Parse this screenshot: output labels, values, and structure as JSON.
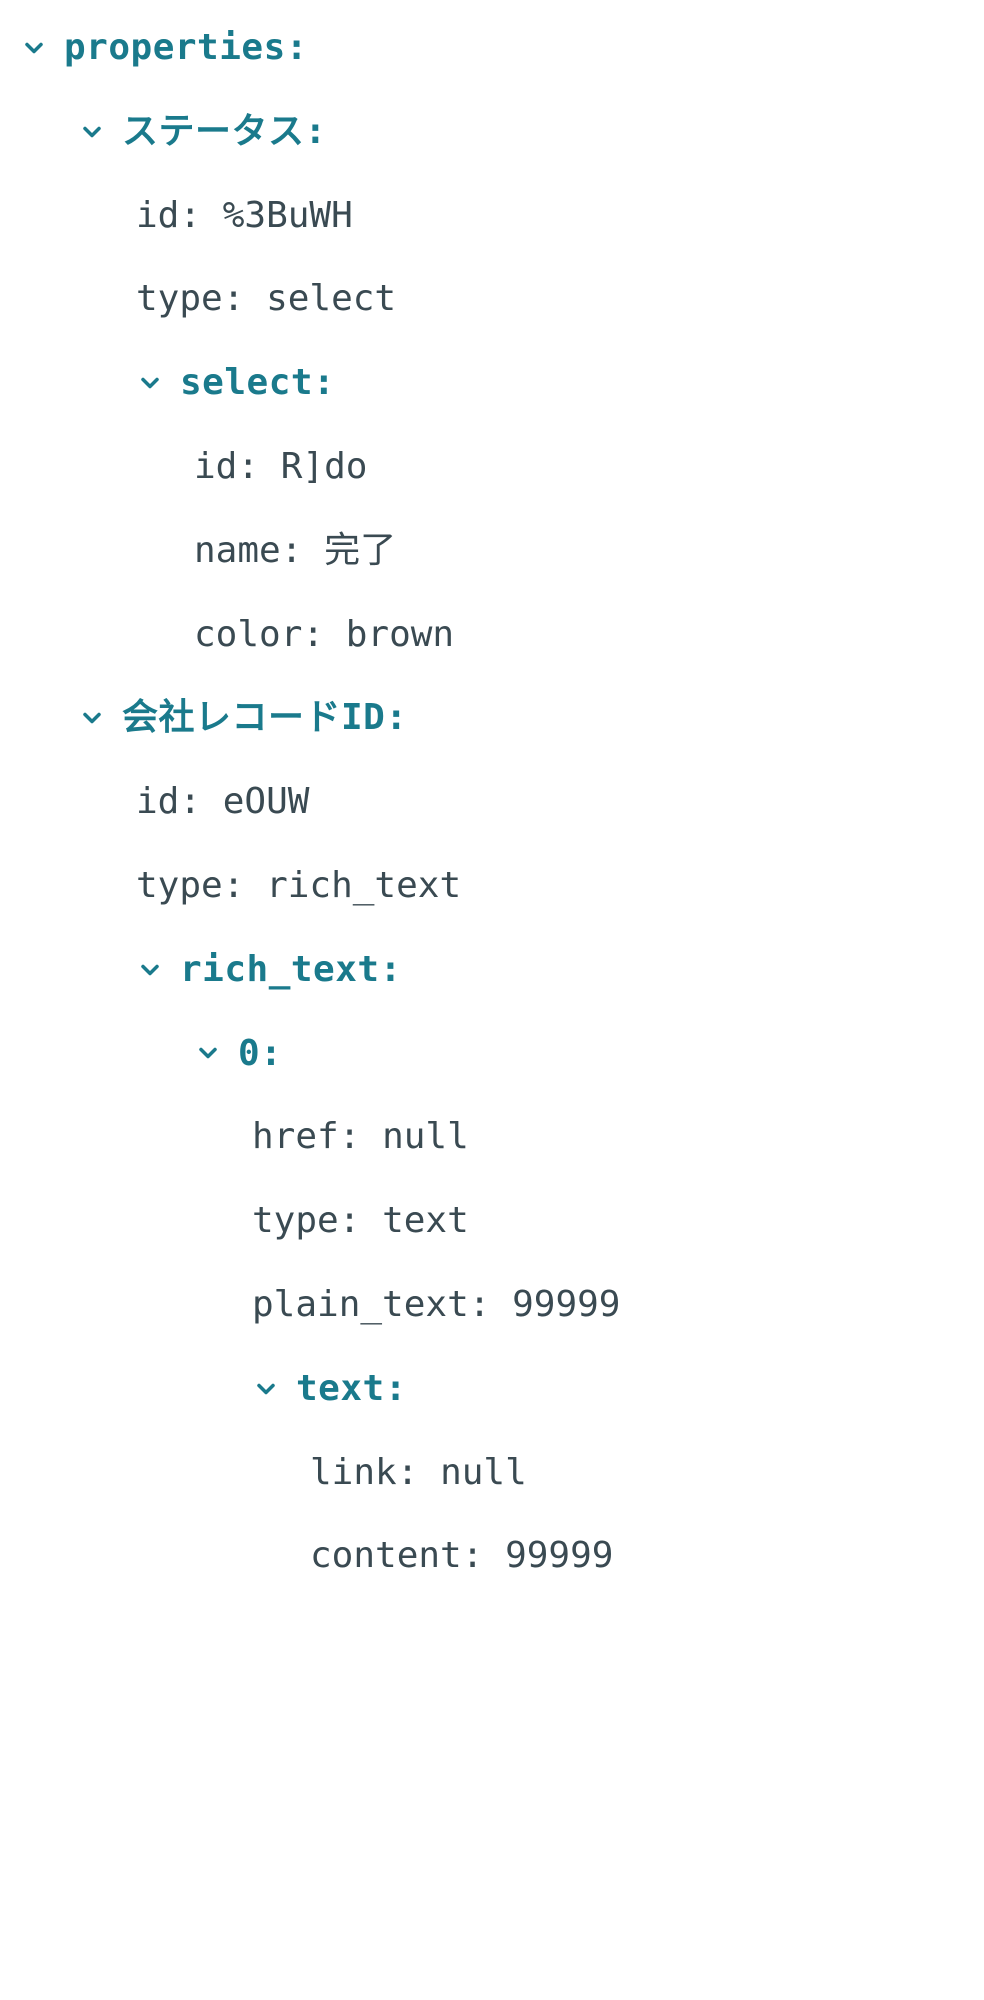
{
  "tree": {
    "properties": {
      "label": "properties:",
      "status": {
        "label": "ステータス:",
        "id_key": "id:",
        "id_value": "%3BuWH",
        "type_key": "type:",
        "type_value": "select",
        "select": {
          "label": "select:",
          "id_key": "id:",
          "id_value": "R]do",
          "name_key": "name:",
          "name_value": "完了",
          "color_key": "color:",
          "color_value": "brown"
        }
      },
      "companyRecordId": {
        "label": "会社レコードID:",
        "id_key": "id:",
        "id_value": "eOUW",
        "type_key": "type:",
        "type_value": "rich_text",
        "rich_text": {
          "label": "rich_text:",
          "item0": {
            "label": "0:",
            "href_key": "href:",
            "href_value": "null",
            "type_key": "type:",
            "type_value": "text",
            "plain_text_key": "plain_text:",
            "plain_text_value": "99999",
            "text": {
              "label": "text:",
              "link_key": "link:",
              "link_value": "null",
              "content_key": "content:",
              "content_value": "99999"
            }
          }
        }
      }
    }
  }
}
